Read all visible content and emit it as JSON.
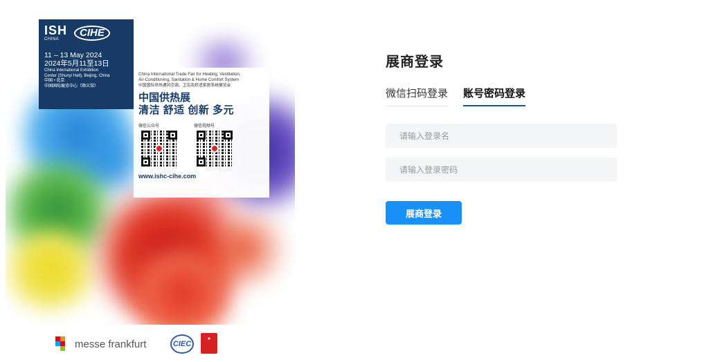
{
  "poster": {
    "ish_logo": "ISH",
    "ish_sub": "CHINA",
    "cihe_logo": "CIHE",
    "dates_en": "11 – 13 May 2024",
    "dates_cn": "2024年5月11至13日",
    "venue_en_1": "China International Exhibition",
    "venue_en_2": "Center (Shunyi Hall), Beijing, China",
    "venue_cn_1": "中国 • 北京",
    "venue_cn_2": "中国国际展览中心（顺义馆）",
    "fair_en_1": "China International Trade Fair for Heating, Ventilation,",
    "fair_en_2": "Air-Conditioning, Sanitation & Home Comfort System",
    "fair_cn": "中国国际供热通风空调、卫浴及舒适家居系统展览会",
    "headline": "中国供热展",
    "slogan": "清洁 舒适 创新 多元",
    "qr1_label": "微信公众号",
    "qr2_label": "微信视频号",
    "url": "www.ishc-cihe.com",
    "footer_messe": "messe frankfurt",
    "footer_ciec": "CIEC"
  },
  "login": {
    "title": "展商登录",
    "tabs": [
      {
        "label": "微信扫码登录",
        "active": false
      },
      {
        "label": "账号密码登录",
        "active": true
      }
    ],
    "username_placeholder": "请输入登录名",
    "password_placeholder": "请输入登录密码",
    "submit_label": "展商登录"
  },
  "colors": {
    "accent_button": "#1890f5",
    "tab_underline": "#16538f",
    "poster_navy": "#173b66",
    "input_bg": "#f4f5f7"
  }
}
